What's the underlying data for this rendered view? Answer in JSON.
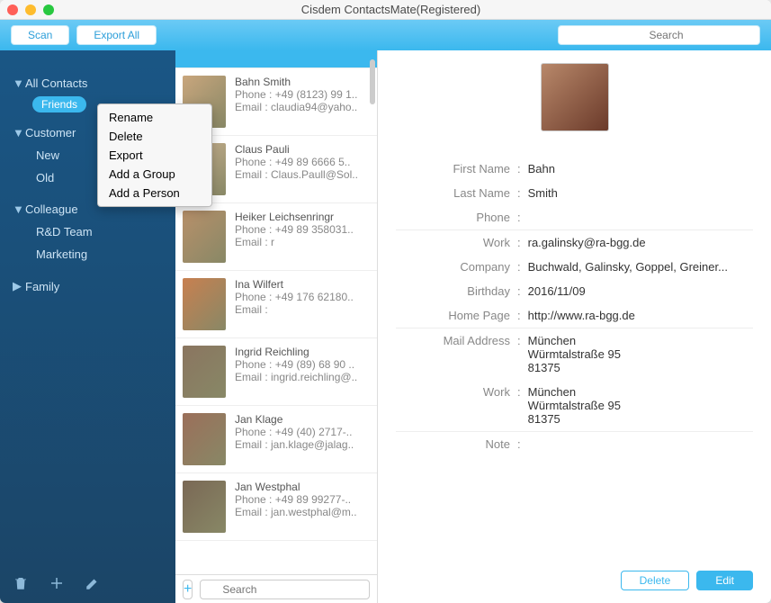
{
  "window": {
    "title": "Cisdem ContactsMate(Registered)"
  },
  "toolbar": {
    "scan_label": "Scan",
    "export_all_label": "Export All",
    "search_placeholder": "Search"
  },
  "sidebar": {
    "all_contacts": "All Contacts",
    "selected_group": "Friends",
    "groups": [
      {
        "label": "Customer",
        "expanded": true,
        "children": [
          {
            "label": "New"
          },
          {
            "label": "Old"
          }
        ]
      },
      {
        "label": "Colleague",
        "expanded": true,
        "children": [
          {
            "label": "R&D Team"
          },
          {
            "label": "Marketing"
          }
        ]
      },
      {
        "label": "Family",
        "expanded": false,
        "children": []
      }
    ]
  },
  "context_menu": {
    "items": [
      "Rename",
      "Delete",
      "Export",
      "Add a Group",
      "Add a Person"
    ]
  },
  "contacts": [
    {
      "name": "Bahn Smith",
      "phone": "Phone : +49 (8123) 99 1..",
      "email": "Email : claudia94@yaho.."
    },
    {
      "name": "Claus Pauli",
      "phone": "Phone : +49 89 6666 5..",
      "email": "Email : Claus.Paull@Sol.."
    },
    {
      "name": "Heiker Leichsenringr",
      "phone": "Phone : +49 89 358031..",
      "email": "Email : r"
    },
    {
      "name": "Ina Wilfert",
      "phone": "Phone : +49 176 62180..",
      "email": "Email :"
    },
    {
      "name": "Ingrid Reichling",
      "phone": "Phone : +49 (89) 68 90 ..",
      "email": "Email : ingrid.reichling@.."
    },
    {
      "name": "Jan Klage",
      "phone": "Phone : +49 (40) 2717-..",
      "email": "Email : jan.klage@jalag.."
    },
    {
      "name": "Jan Westphal",
      "phone": "Phone : +49 89 99277-..",
      "email": "Email : jan.westphal@m.."
    }
  ],
  "list_footer": {
    "search_placeholder": "Search"
  },
  "detail": {
    "fields": [
      {
        "label": "First Name",
        "value": "Bahn"
      },
      {
        "label": "Last Name",
        "value": "Smith"
      },
      {
        "label": "Phone",
        "value": ""
      },
      {
        "label": "Work",
        "value": "ra.galinsky@ra-bgg.de"
      },
      {
        "label": "Company",
        "value": "Buchwald, Galinsky, Goppel, Greiner..."
      },
      {
        "label": "Birthday",
        "value": "2016/11/09"
      },
      {
        "label": "Home Page",
        "value": "http://www.ra-bgg.de"
      },
      {
        "label": "Mail Address",
        "value": "München\nWürmtalstraße 95\n81375"
      },
      {
        "label": "Work",
        "value": "München\nWürmtalstraße 95\n81375"
      },
      {
        "label": "Note",
        "value": ""
      }
    ],
    "delete_label": "Delete",
    "edit_label": "Edit"
  }
}
